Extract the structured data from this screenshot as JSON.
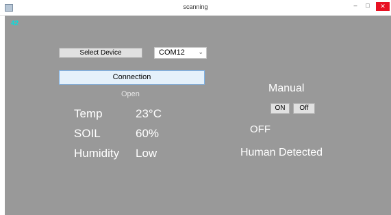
{
  "window": {
    "title": "scanning",
    "minimize_symbol": "–",
    "maximize_symbol": "□",
    "close_symbol": "✕"
  },
  "counter": "42",
  "device": {
    "select_label": "Select Device",
    "port_value": "COM12",
    "dropdown_icon": "chevron-down-icon"
  },
  "connection": {
    "button_label": "Connection",
    "status": "Open"
  },
  "sensors": {
    "temp_label": "Temp",
    "temp_value": "23°C",
    "soil_label": "SOIL",
    "soil_value": "60%",
    "humidity_label": "Humidity",
    "humidity_value": "Low"
  },
  "control": {
    "mode": "Manual",
    "on_label": "ON",
    "off_label": "Off",
    "state": "OFF",
    "detection": "Human Detected"
  },
  "colors": {
    "background": "#999999",
    "text": "#ffffff",
    "counter": "#00e0e0",
    "close_button": "#e81123",
    "connection_button": "#e5f1fb"
  }
}
